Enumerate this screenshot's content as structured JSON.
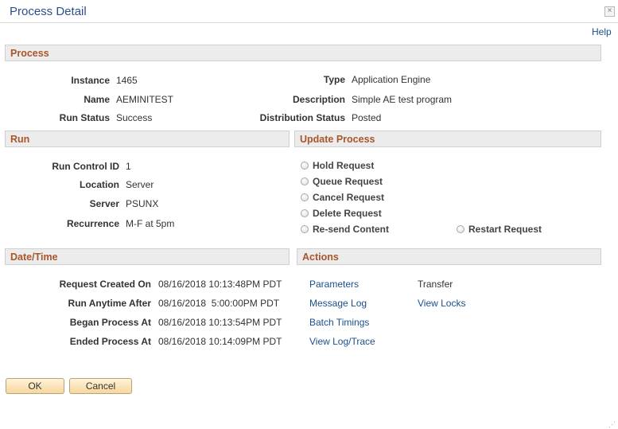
{
  "window": {
    "title": "Process Detail",
    "close_glyph": "×",
    "help_label": "Help"
  },
  "process": {
    "header": "Process",
    "instance_label": "Instance",
    "instance": "1465",
    "name_label": "Name",
    "name": "AEMINITEST",
    "run_status_label": "Run Status",
    "run_status": "Success",
    "type_label": "Type",
    "type": "Application Engine",
    "description_label": "Description",
    "description": "Simple AE test program",
    "distribution_status_label": "Distribution Status",
    "distribution_status": "Posted"
  },
  "run": {
    "header": "Run",
    "run_control_id_label": "Run Control ID",
    "run_control_id": "1",
    "location_label": "Location",
    "location": "Server",
    "server_label": "Server",
    "server": "PSUNX",
    "recurrence_label": "Recurrence",
    "recurrence": "M-F at 5pm"
  },
  "update_process": {
    "header": "Update Process",
    "options": [
      {
        "label": "Hold Request"
      },
      {
        "label": "Queue Request"
      },
      {
        "label": "Cancel Request"
      },
      {
        "label": "Delete Request"
      },
      {
        "label": "Re-send Content"
      },
      {
        "label": "Restart Request"
      }
    ]
  },
  "datetime": {
    "header": "Date/Time",
    "request_created_on_label": "Request Created On",
    "request_created_on": "08/16/2018 10:13:48PM PDT",
    "run_anytime_after_label": "Run Anytime After",
    "run_anytime_after": "08/16/2018  5:00:00PM PDT",
    "began_process_at_label": "Began Process At",
    "began_process_at": "08/16/2018 10:13:54PM PDT",
    "ended_process_at_label": "Ended Process At",
    "ended_process_at": "08/16/2018 10:14:09PM PDT"
  },
  "actions": {
    "header": "Actions",
    "parameters": "Parameters",
    "transfer": "Transfer",
    "message_log": "Message Log",
    "view_locks": "View Locks",
    "batch_timings": "Batch Timings",
    "view_log_trace": "View Log/Trace"
  },
  "buttons": {
    "ok": "OK",
    "cancel": "Cancel"
  },
  "colors": {
    "link": "#1a4f8b",
    "section_header_text": "#a8562a",
    "section_header_bg": "#ececec",
    "button_bg": "#f7d79c"
  }
}
